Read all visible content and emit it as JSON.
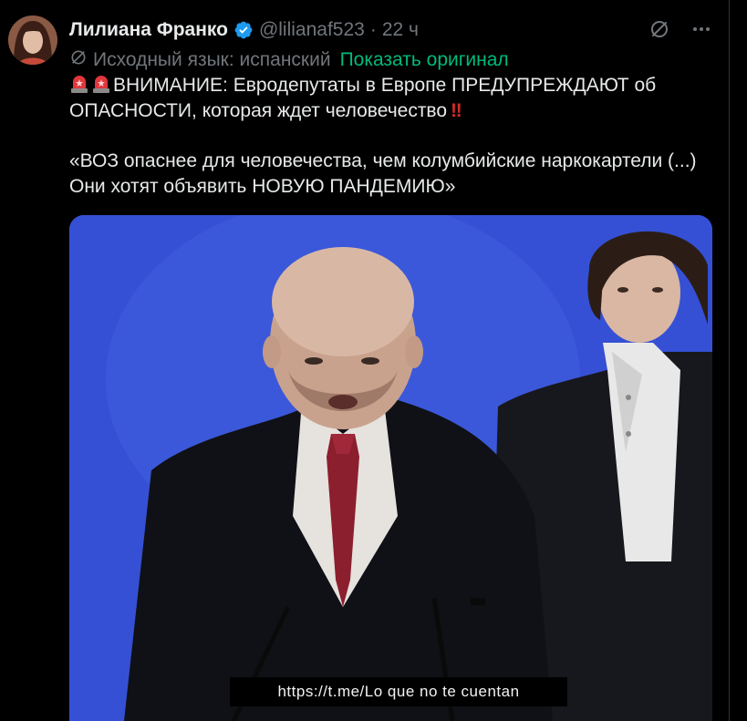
{
  "author": {
    "name": "Лилиана Франко",
    "handle": "@lilianaf523",
    "separator": "·",
    "time": "22 ч"
  },
  "icons": {
    "verified": "verified-badge-icon",
    "grok": "slash-circle-icon",
    "more": "more-dots-icon",
    "siren": "police-light-icon",
    "bangbang": "double-exclamation-icon"
  },
  "translation": {
    "source_label": "Исходный язык: испанский",
    "show_original": "Показать оригинал"
  },
  "tweet": {
    "line1_text": "ВНИМАНИЕ: Евродепутаты в Европе ПРЕДУПРЕЖДАЮТ об ОПАСНОСТИ, которая ждет человечество",
    "bangbang": "‼",
    "line2_text": "«ВОЗ опаснее для человечества, чем колумбийские наркокартели (...) Они хотят объявить НОВУЮ ПАНДЕМИЮ»"
  },
  "media": {
    "caption": "https://t.me/Lo que no te cuentan"
  },
  "colors": {
    "background": "#000000",
    "text": "#e7e9ea",
    "muted": "#71767b",
    "link_green": "#00ba7c",
    "verified_blue": "#1d9bf0",
    "video_blue": "#3653d6"
  }
}
